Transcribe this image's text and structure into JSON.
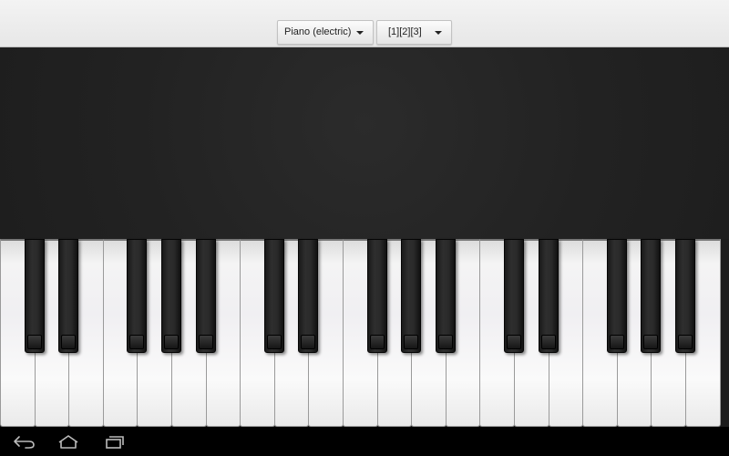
{
  "toolbar": {
    "instrument": {
      "selected": "Piano (electric)",
      "icon": "dropdown-arrow-icon"
    },
    "layout": {
      "selected": "[1][2][3]",
      "icon": "dropdown-arrow-icon"
    }
  },
  "keyboard": {
    "white_keys": 21,
    "black_key_pattern": "C# D# - F# G# A# -",
    "colors": {
      "white": "#f4f4f4",
      "black": "#1f1f1f",
      "panel": "#222222"
    }
  },
  "navbar": {
    "buttons": [
      "back-icon",
      "home-icon",
      "recents-icon"
    ]
  }
}
